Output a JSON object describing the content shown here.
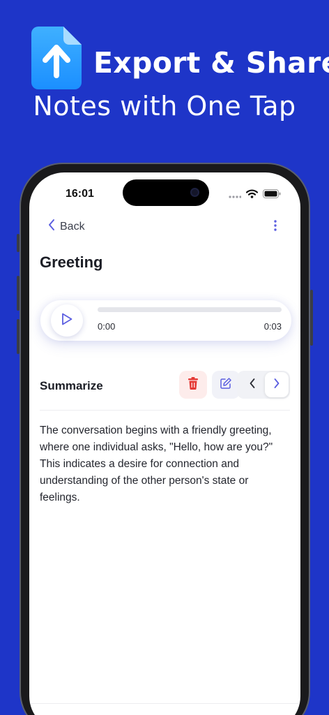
{
  "promo": {
    "title": "Export & Share",
    "subtitle": "Notes with One Tap",
    "icon": "upload-file-icon"
  },
  "status_bar": {
    "time": "16:01",
    "icons": [
      "cellular-icon",
      "wifi-icon",
      "battery-icon"
    ]
  },
  "nav": {
    "back_label": "Back",
    "back_icon": "chevron-left-icon",
    "more_icon": "more-vertical-icon"
  },
  "note": {
    "title": "Greeting"
  },
  "player": {
    "current_time": "0:00",
    "duration": "0:03",
    "progress": 0,
    "play_icon": "play-icon"
  },
  "summary_section": {
    "label": "Summarize",
    "delete_icon": "trash-icon",
    "edit_icon": "edit-icon",
    "prev_icon": "chevron-left-icon",
    "next_icon": "chevron-right-icon",
    "text": "The conversation begins with a friendly greeting, where one individual asks, \"Hello, how are you?\" This indicates a desire for connection and understanding of the other person's state or feelings."
  },
  "colors": {
    "background": "#1e35c8",
    "accent": "#5b5ee0",
    "delete": "#e53935"
  }
}
